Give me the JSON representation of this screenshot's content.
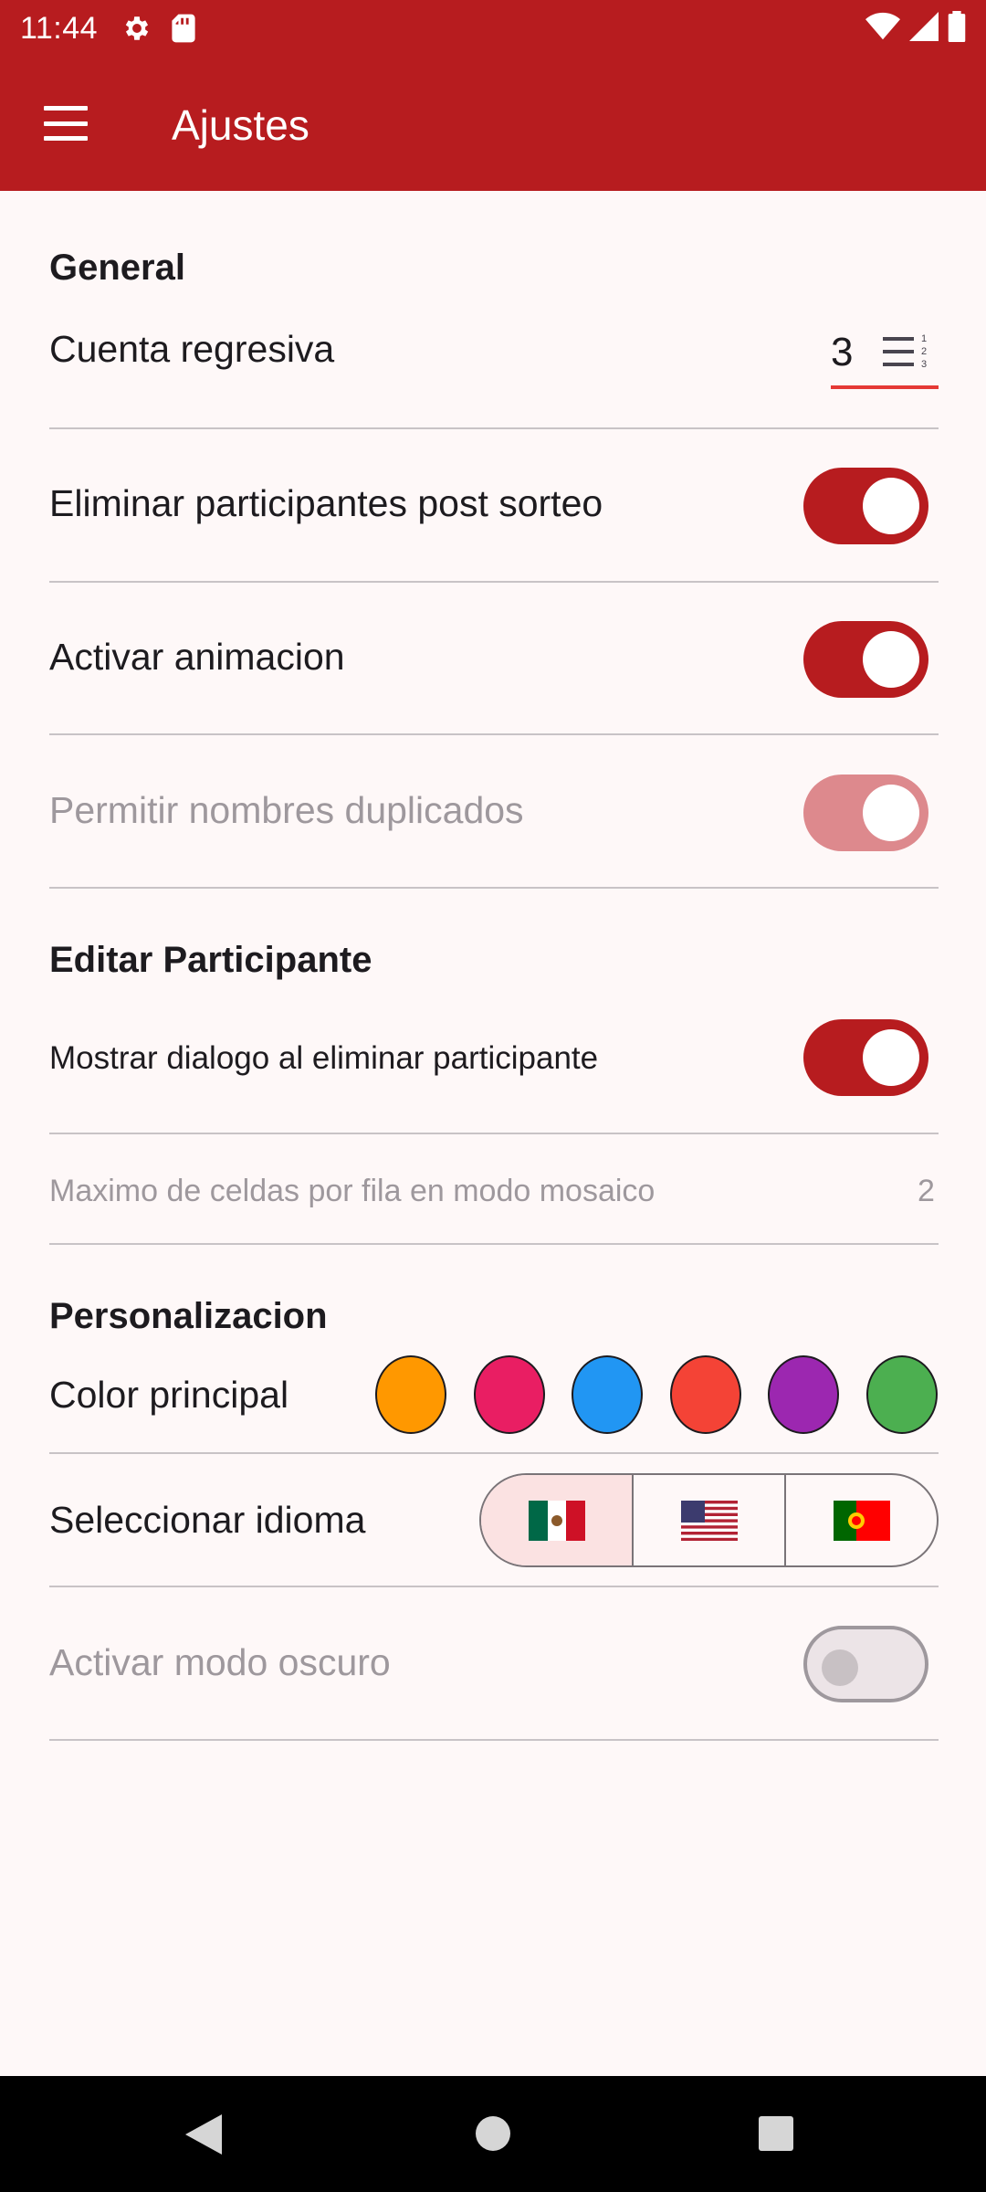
{
  "status_bar": {
    "time": "11:44",
    "icons": [
      "gear-icon",
      "sd-card-icon",
      "wifi-icon",
      "signal-icon",
      "battery-icon"
    ]
  },
  "app_bar": {
    "title": "Ajustes",
    "menu_icon": "hamburger-menu-icon",
    "background": "#B71C1F"
  },
  "general": {
    "title": "General",
    "countdown": {
      "label": "Cuenta regresiva",
      "value": "3",
      "icon": "numbered-list-icon"
    },
    "remove_after_draw": {
      "label": "Eliminar participantes post sorteo",
      "on": true
    },
    "animation": {
      "label": "Activar animacion",
      "on": true
    },
    "duplicates": {
      "label": "Permitir nombres duplicados",
      "on": true,
      "enabled": false
    }
  },
  "edit_participant": {
    "title": "Editar Participante",
    "confirm_dialog": {
      "label": "Mostrar dialogo al eliminar participante",
      "on": true
    },
    "max_cells": {
      "label": "Maximo de celdas por fila en modo mosaico",
      "value": "2"
    }
  },
  "personalization": {
    "title": "Personalizacion",
    "color": {
      "label": "Color principal",
      "options": [
        "#FF9800",
        "#E91E63",
        "#2196F3",
        "#F44336",
        "#9C27B0",
        "#4CAF50"
      ]
    },
    "language": {
      "label": "Seleccionar idioma",
      "options": [
        "mexico-flag-icon",
        "usa-flag-icon",
        "portugal-flag-icon"
      ],
      "selected": 0
    },
    "dark_mode": {
      "label": "Activar modo oscuro",
      "on": false,
      "enabled": false
    }
  },
  "nav_bar": {
    "buttons": [
      "back-icon",
      "home-icon",
      "recents-icon"
    ]
  }
}
